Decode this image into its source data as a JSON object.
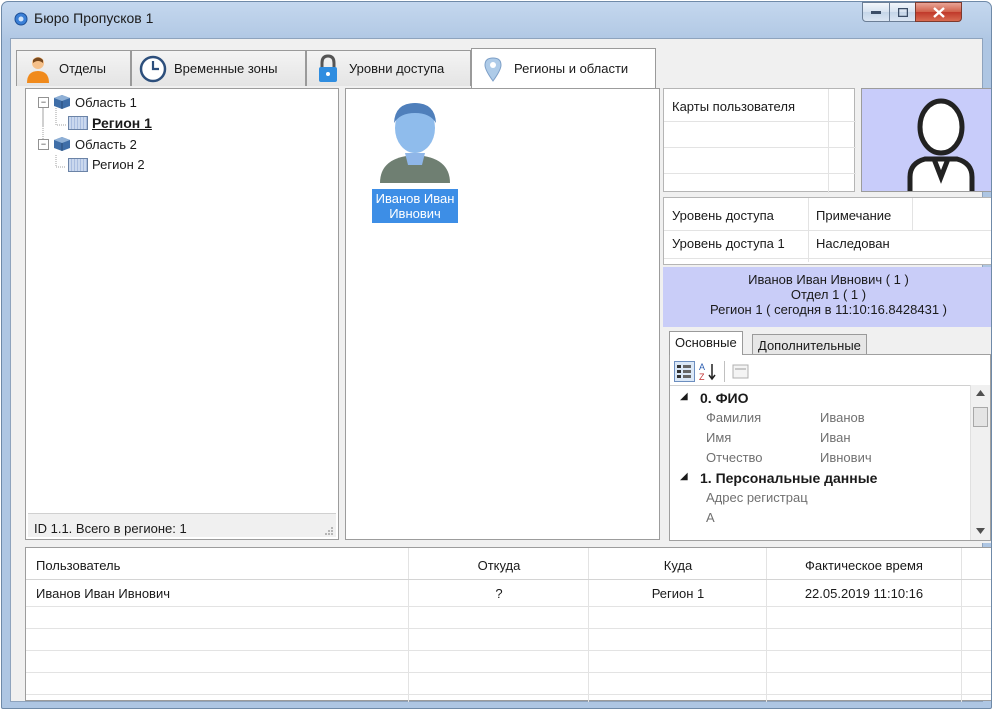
{
  "window": {
    "title": "Бюро Пропусков 1"
  },
  "tabs": [
    {
      "label": "Отделы",
      "icon": "person-icon"
    },
    {
      "label": "Временные зоны",
      "icon": "clock-icon"
    },
    {
      "label": "Уровни доступа",
      "icon": "lock-icon"
    },
    {
      "label": "Регионы и области",
      "icon": "map-pin-icon",
      "active": true
    }
  ],
  "tree": {
    "items": [
      {
        "label": "Область 1",
        "level": 0,
        "expander": "⊟"
      },
      {
        "label": "Регион 1",
        "level": 1,
        "selected": true
      },
      {
        "label": "Область 2",
        "level": 0,
        "expander": "⊟"
      },
      {
        "label": "Регион 2",
        "level": 1
      }
    ],
    "status": "ID 1.1. Всего в регионе: 1"
  },
  "users_view": {
    "user_name": "Иванов Иван Ивнович"
  },
  "cards": {
    "header": "Карты пользователя"
  },
  "access": {
    "headers": [
      "Уровень доступа",
      "Примечание"
    ],
    "rows": [
      [
        "Уровень доступа 1",
        "Наследован"
      ]
    ]
  },
  "info": {
    "line1": "Иванов Иван Ивнович ( 1 )",
    "line2": "Отдел 1 ( 1 )",
    "line3": "Регион 1 ( сегодня в 11:10:16.8428431 )"
  },
  "props": {
    "tabs": [
      "Основные",
      "Дополнительные"
    ],
    "categories": [
      {
        "label": "0. ФИО",
        "rows": [
          [
            "Фамилия",
            "Иванов"
          ],
          [
            "Имя",
            "Иван"
          ],
          [
            "Отчество",
            "Ивнович"
          ]
        ]
      },
      {
        "label": "1. Персональные данные",
        "rows": [
          [
            "Адрес регистрац",
            ""
          ]
        ]
      }
    ]
  },
  "log": {
    "headers": [
      "Пользователь",
      "Откуда",
      "Куда",
      "Фактическое время"
    ],
    "rows": [
      [
        "Иванов Иван Ивнович",
        "?",
        "Регион 1",
        "22.05.2019 11:10:16"
      ]
    ]
  },
  "colors": {
    "accent": "#3d8ee6",
    "info_bg": "#c9cdf8",
    "avatar_bg": "#c8ccfa"
  }
}
